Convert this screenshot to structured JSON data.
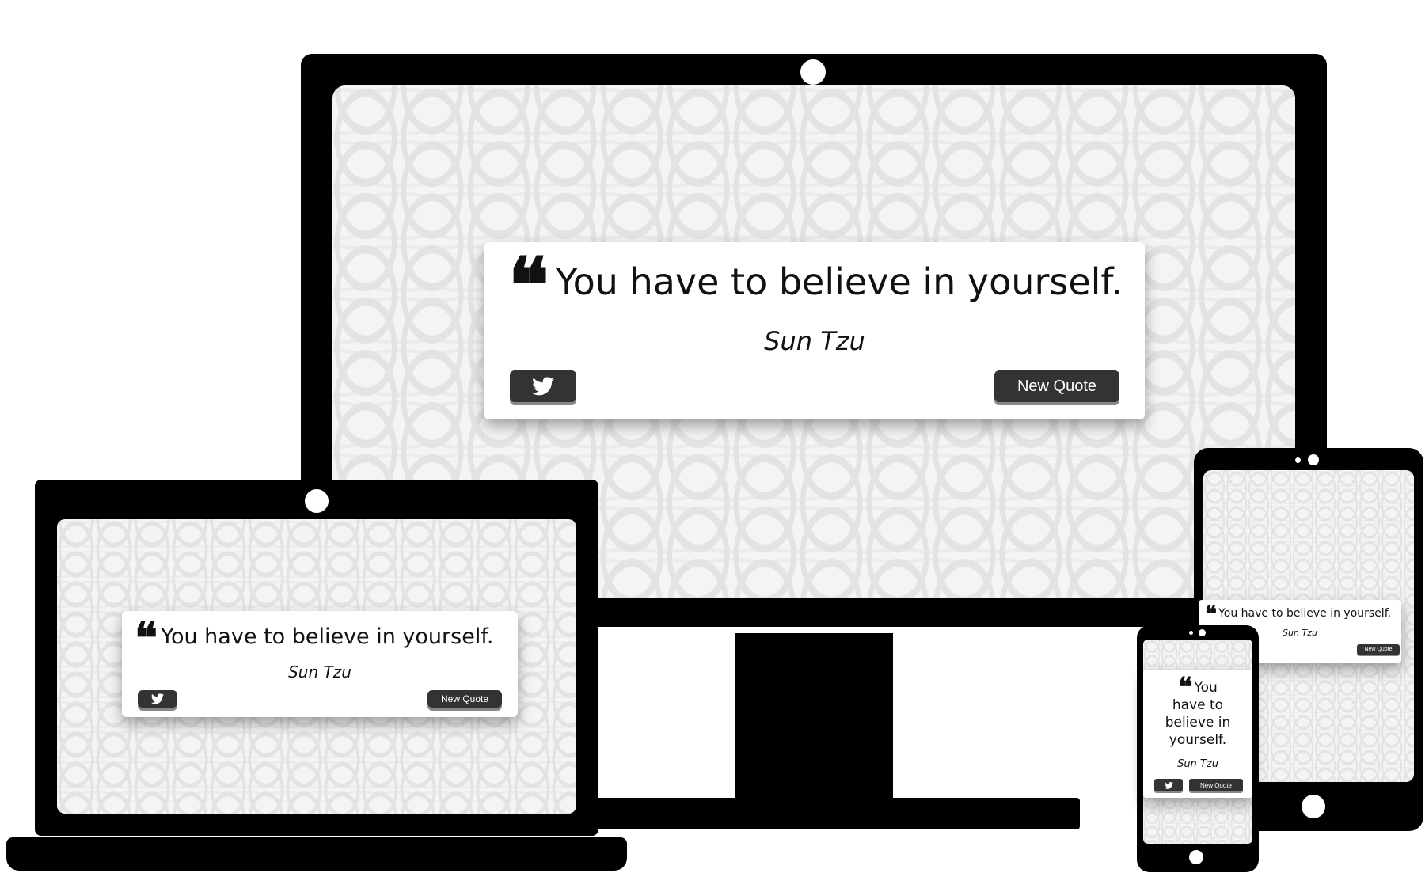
{
  "quote": {
    "mark": "❝",
    "text": "You have to believe in yourself.",
    "author": "Sun Tzu",
    "new_quote_label": "New Quote",
    "tweet_icon": "twitter-icon"
  },
  "phone_quote_lines": [
    "You",
    "have to",
    "believe in",
    "yourself."
  ],
  "colors": {
    "frame": "#000000",
    "button": "#333333",
    "card": "#ffffff",
    "pattern": "#e3e3e3"
  }
}
